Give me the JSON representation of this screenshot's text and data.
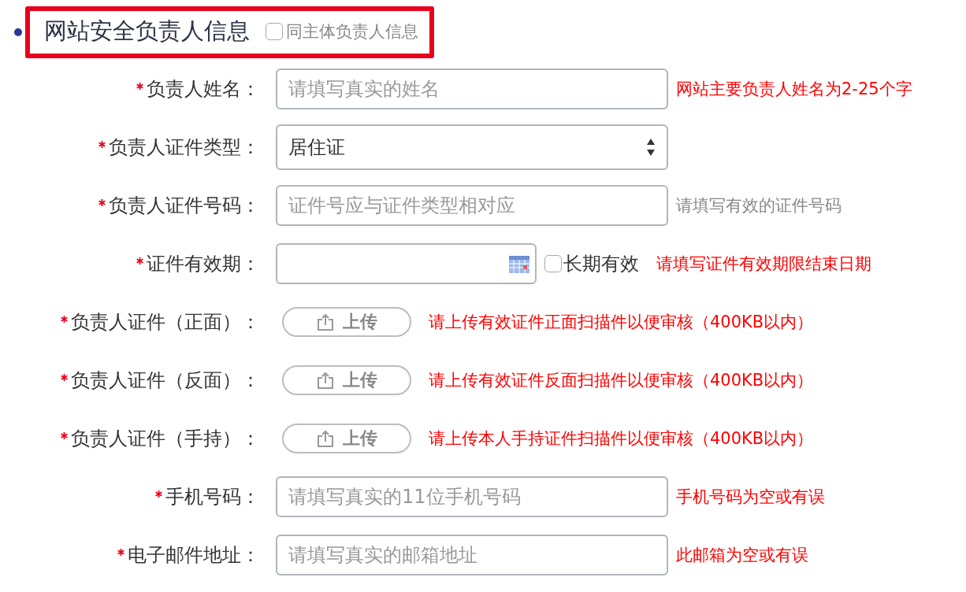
{
  "section": {
    "title": "网站安全负责人信息",
    "highlighted": true,
    "same_as": {
      "label": "同主体负责人信息",
      "checked": false
    }
  },
  "fields": [
    {
      "kind": "text",
      "label": "负责人姓名：",
      "required": true,
      "placeholder": "请填写真实的姓名",
      "hint": {
        "text": "网站主要负责人姓名为2-25个字",
        "color": "#ff0000"
      }
    },
    {
      "kind": "select",
      "label": "负责人证件类型：",
      "required": true,
      "value": "居住证"
    },
    {
      "kind": "text",
      "label": "负责人证件号码：",
      "required": true,
      "placeholder": "证件号应与证件类型相对应",
      "hint": {
        "text": "请填写有效的证件号码",
        "color": "#888888"
      }
    },
    {
      "kind": "date",
      "label": "证件有效期：",
      "required": true,
      "option": {
        "label": "长期有效",
        "checked": false
      },
      "hint": {
        "text": "请填写证件有效期限结束日期",
        "color": "#ff0000"
      }
    },
    {
      "kind": "upload",
      "label": "负责人证件（正面）：",
      "required": true,
      "button": "上传",
      "hint": {
        "text": "请上传有效证件正面扫描件以便审核（400KB以内）",
        "color": "#ff0000"
      }
    },
    {
      "kind": "upload",
      "label": "负责人证件（反面）：",
      "required": true,
      "button": "上传",
      "hint": {
        "text": "请上传有效证件反面扫描件以便审核（400KB以内）",
        "color": "#ff0000"
      }
    },
    {
      "kind": "upload",
      "label": "负责人证件（手持）：",
      "required": true,
      "button": "上传",
      "hint": {
        "text": "请上传本人手持证件扫描件以便审核（400KB以内）",
        "color": "#ff0000"
      }
    },
    {
      "kind": "text",
      "label": "手机号码：",
      "required": true,
      "placeholder": "请填写真实的11位手机号码",
      "hint": {
        "text": "手机号码为空或有误",
        "color": "#ff0000"
      }
    },
    {
      "kind": "text",
      "label": "电子邮件地址：",
      "required": true,
      "placeholder": "请填写真实的邮箱地址",
      "hint": {
        "text": "此邮箱为空或有误",
        "color": "#ff0000"
      }
    }
  ]
}
